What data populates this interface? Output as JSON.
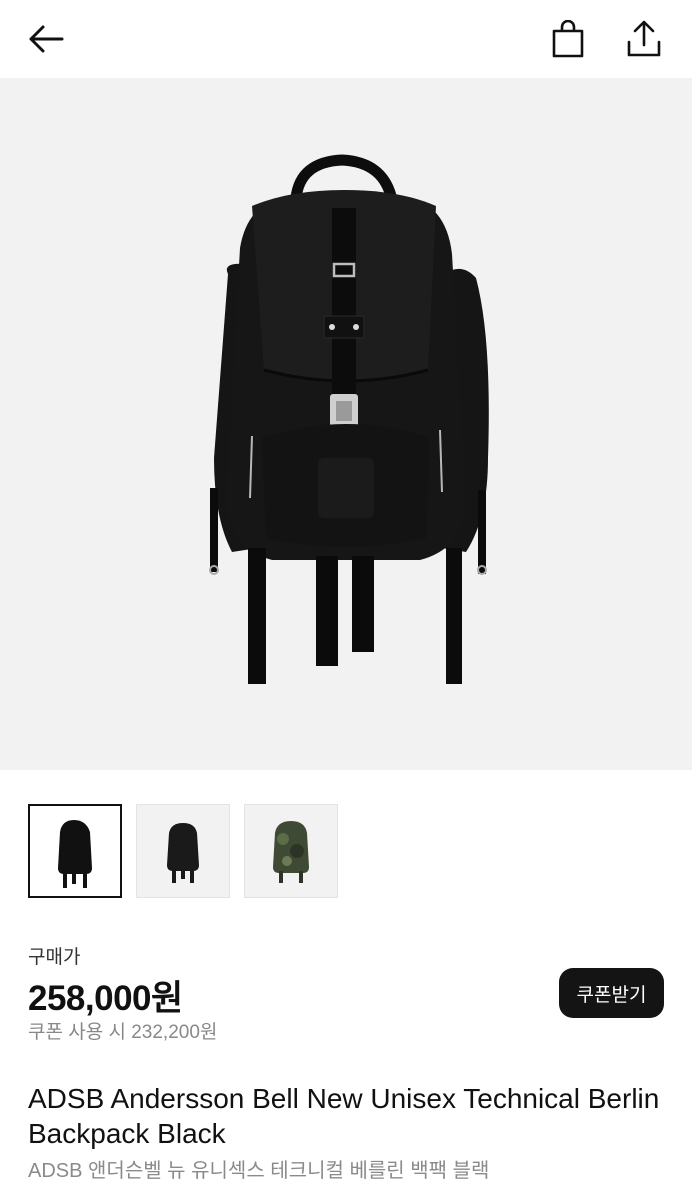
{
  "header": {
    "back_icon": "arrow-left-icon",
    "bag_icon": "shopping-bag-icon",
    "share_icon": "share-upload-icon"
  },
  "gallery": {
    "main_image": "black-technical-backpack-photo",
    "thumbnails": [
      {
        "label": "black backpack front",
        "color": "#111111",
        "selected": true
      },
      {
        "label": "black backpack alt",
        "color": "#1a1a1a",
        "selected": false
      },
      {
        "label": "camo backpack",
        "color": "#3f4a34",
        "selected": false
      }
    ]
  },
  "pricing": {
    "label": "구매가",
    "price": "258,000원",
    "coupon_price": "쿠폰 사용 시 232,200원",
    "coupon_button": "쿠폰받기"
  },
  "product": {
    "title": "ADSB Andersson Bell New Unisex Technical Berlin Backpack Black",
    "subtitle": "ADSB 앤더슨벨 뉴 유니섹스 테크니컬 베를린 백팩 블랙"
  },
  "colors": {
    "accent_dark": "#141414",
    "hero_bg": "#f2f2f2",
    "muted_text": "#888888"
  }
}
